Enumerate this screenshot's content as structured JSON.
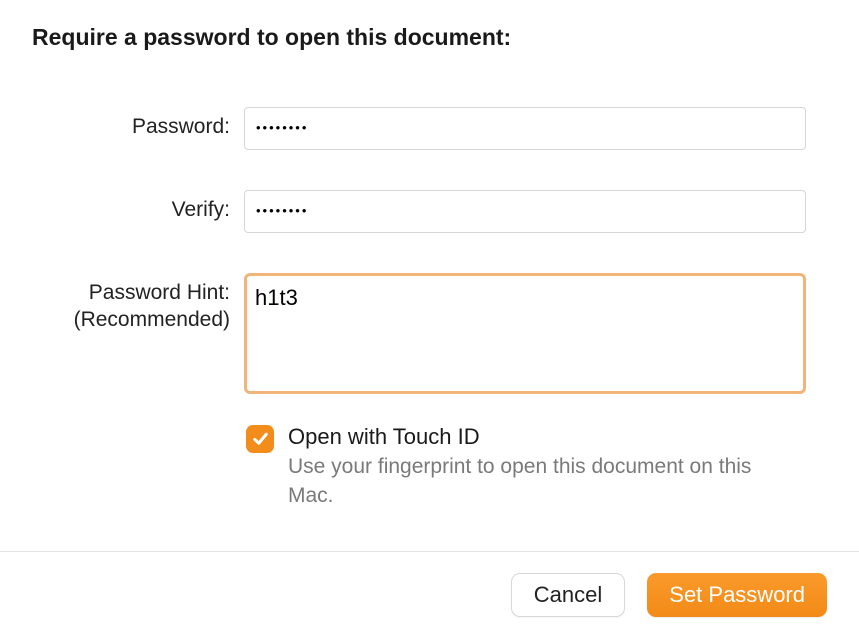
{
  "title": "Require a password to open this document:",
  "fields": {
    "password": {
      "label": "Password:",
      "value": "••••••••"
    },
    "verify": {
      "label": "Verify:",
      "value": "••••••••"
    },
    "hint": {
      "label_line1": "Password Hint:",
      "label_line2": "(Recommended)",
      "value": "h1t3"
    }
  },
  "touchid": {
    "checked": true,
    "label": "Open with Touch ID",
    "description": "Use your fingerprint to open this document on this Mac."
  },
  "buttons": {
    "cancel": "Cancel",
    "set_password": "Set Password"
  },
  "colors": {
    "accent": "#f28c1b",
    "focus_ring": "#f0b57a"
  }
}
